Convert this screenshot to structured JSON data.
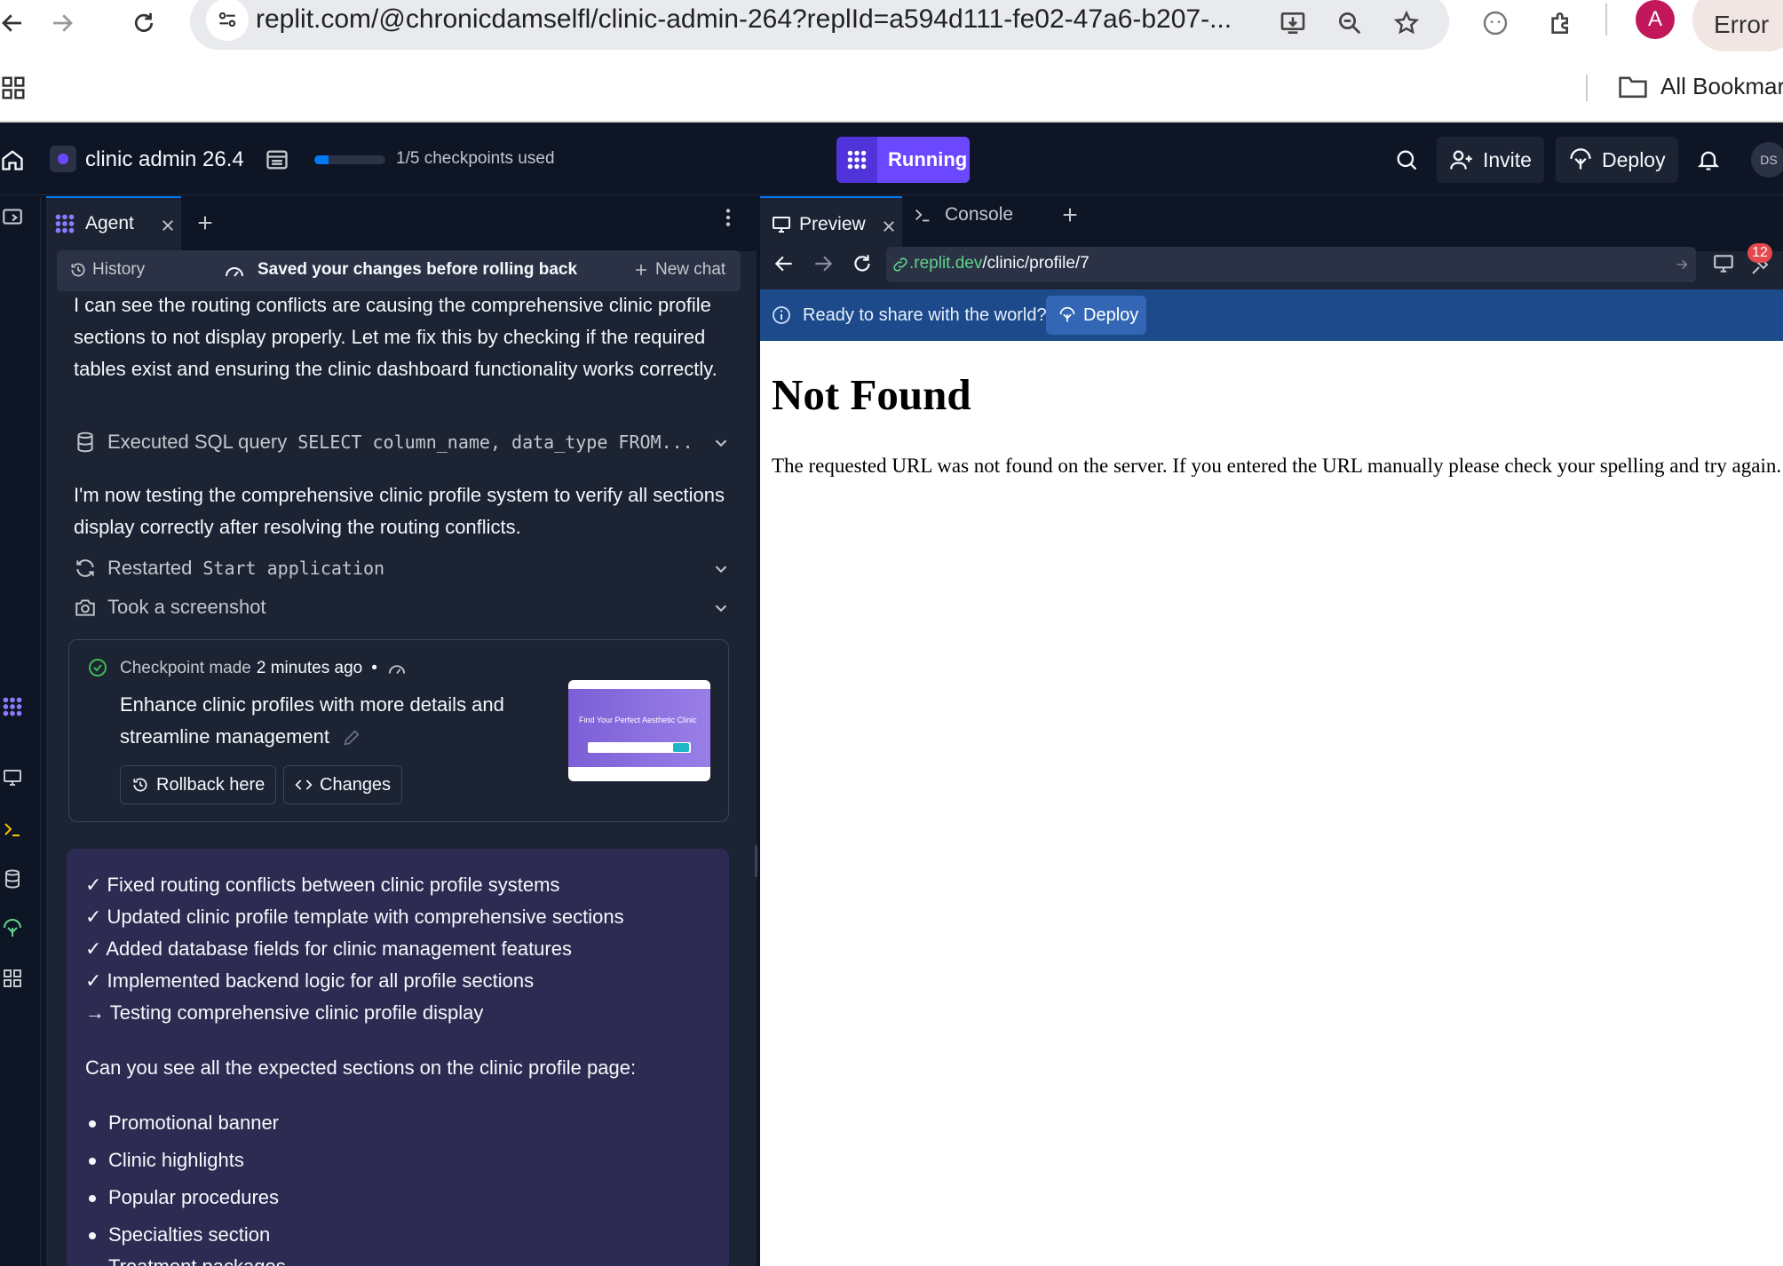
{
  "browser": {
    "url": "replit.com/@chronicdamselfl/clinic-admin-264?replId=a594d111-fe02-47a6-b207-...",
    "avatar_letter": "A",
    "error_label": "Error",
    "bookmarks_label": "All Bookmarks"
  },
  "app": {
    "project_title": "clinic admin 26.4",
    "checkpoints_text": "1/5 checkpoints used",
    "checkpoints_used_fraction": 0.2,
    "status_label": "Running",
    "invite_label": "Invite",
    "deploy_label": "Deploy",
    "user_initials": "DS",
    "accent_color": "#6b48ff"
  },
  "agent": {
    "tab_label": "Agent",
    "history_label": "History",
    "status_text": "Saved your changes before rolling back",
    "new_chat_label": "New chat",
    "message_1": "I can see the routing conflicts are causing the comprehensive clinic profile sections to not display properly. Let me fix this by checking if the required tables exist and ensuring the clinic dashboard functionality works correctly.",
    "step_sql_label": "Executed SQL query",
    "step_sql_code": "SELECT column_name, data_type FROM...",
    "message_2": "I'm now testing the comprehensive clinic profile system to verify all sections display correctly after resolving the routing conflicts.",
    "step_restart_label": "Restarted",
    "step_restart_code": "Start application",
    "step_screenshot_label": "Took a screenshot",
    "checkpoint": {
      "prefix": "Checkpoint made",
      "time": "2 minutes ago",
      "dot": "•",
      "title": "Enhance clinic profiles with more details and streamline management",
      "rollback_label": "Rollback here",
      "changes_label": "Changes",
      "thumb_heading": "Find Your Perfect Aesthetic Clinic"
    },
    "summary": {
      "items": [
        "✓ Fixed routing conflicts between clinic profile systems",
        "✓ Updated clinic profile template with comprehensive sections",
        "✓ Added database fields for clinic management features",
        "✓ Implemented backend logic for all profile sections",
        "→ Testing comprehensive clinic profile display"
      ],
      "question": "Can you see all the expected sections on the clinic profile page:",
      "bullets": [
        "Promotional banner",
        "Clinic highlights",
        "Popular procedures",
        "Specialties section",
        "Treatment packages"
      ]
    }
  },
  "preview": {
    "tab_label": "Preview",
    "console_label": "Console",
    "url_domain": ".replit.dev",
    "url_path": "/clinic/profile/7",
    "badge_count": "12",
    "deploy_prompt": "Ready to share with the world?",
    "deploy_button": "Deploy",
    "page_title": "Not Found",
    "page_message": "The requested URL was not found on the server. If you entered the URL manually please check your spelling and try again."
  }
}
